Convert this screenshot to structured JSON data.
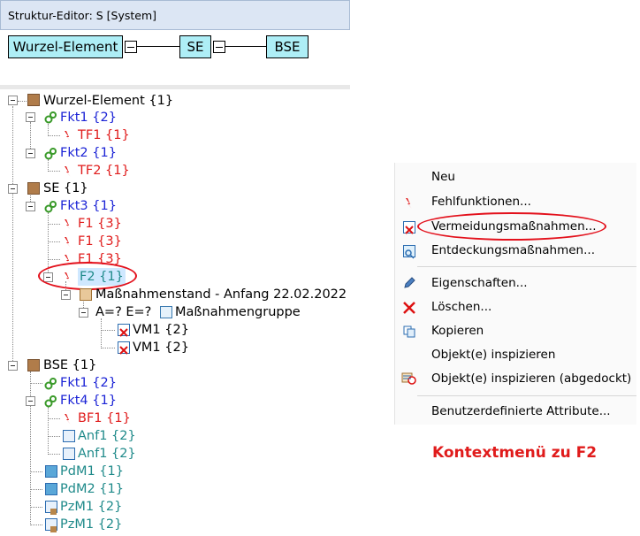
{
  "window": {
    "title": "Struktur-Editor: S [System]"
  },
  "chain": {
    "n1": "Wurzel-Element",
    "n2": "SE",
    "n3": "BSE"
  },
  "tree": {
    "r1": "Wurzel-Element {1}",
    "r2": "Fkt1 {2}",
    "r3": "TF1 {1}",
    "r4": "Fkt2 {1}",
    "r5": "TF2 {1}",
    "r6": "SE {1}",
    "r7": "Fkt3 {1}",
    "r8": "F1 {3}",
    "r9": "F1 {3}",
    "r10": "F1 {3}",
    "r11": "F2 {1}",
    "r12": "Maßnahmenstand - Anfang 22.02.2022",
    "r13a": "A=? E=?",
    "r13b": "Maßnahmengruppe",
    "r14": "VM1 {2}",
    "r15": "VM1 {2}",
    "r16": "BSE {1}",
    "r17": "Fkt1 {2}",
    "r18": "Fkt4 {1}",
    "r19": "BF1 {1}",
    "r20": "Anf1 {2}",
    "r21": "Anf1 {2}",
    "r22": "PdM1 {1}",
    "r23": "PdM2 {1}",
    "r24": "PzM1 {2}",
    "r25": "PzM1 {2}"
  },
  "menu": {
    "neu": "Neu",
    "fehlfunktionen": "Fehlfunktionen...",
    "vermeidung": "Vermeidungsmaßnahmen...",
    "entdeckung": "Entdeckungsmaßnahmen...",
    "eigenschaften": "Eigenschaften...",
    "loeschen": "Löschen...",
    "kopieren": "Kopieren",
    "inspizieren": "Objekt(e) inspizieren",
    "inspizieren_dock": "Objekt(e) inspizieren (abgedockt)",
    "attribute": "Benutzerdefinierte Attribute..."
  },
  "caption": "Kontextmenü zu F2",
  "colors": {
    "function": "#1c24d6",
    "failure": "#e01b1b",
    "requirement": "#1f8a8a",
    "highlight": "#e3111c",
    "node_fill": "#aeeef6"
  }
}
